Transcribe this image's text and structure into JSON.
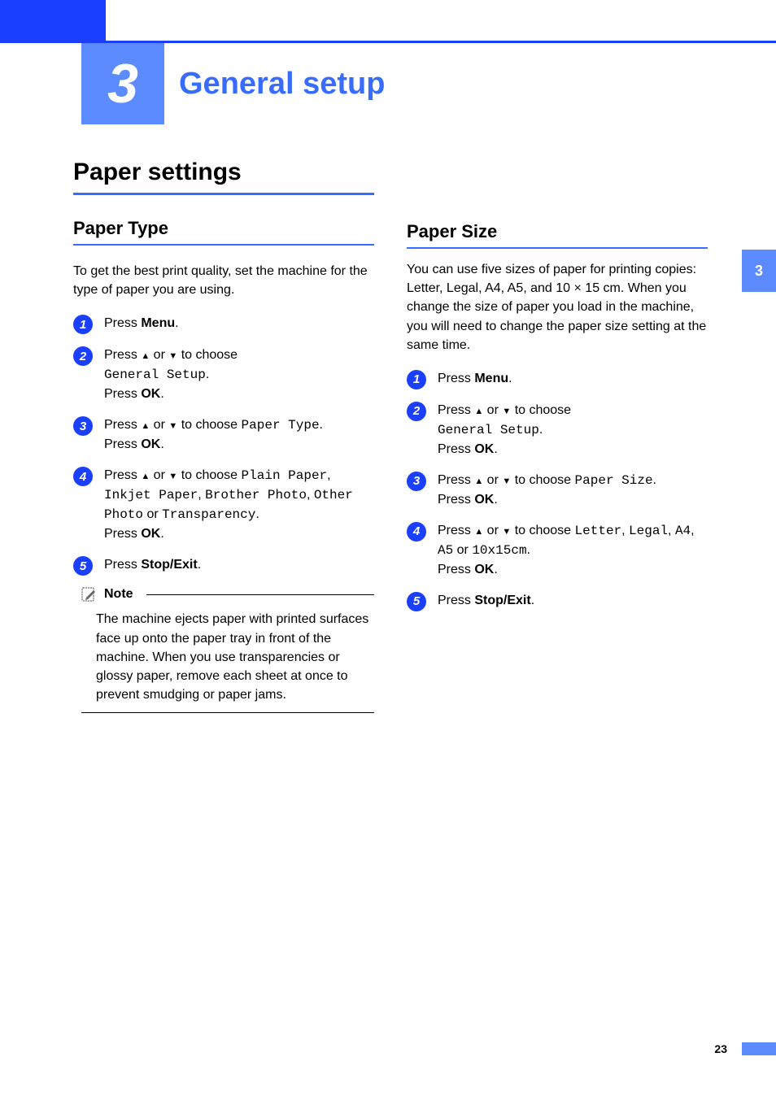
{
  "chapter": {
    "number": "3",
    "title": "General setup"
  },
  "side_tab": "3",
  "page_number": "23",
  "left": {
    "h1": "Paper settings",
    "h2": "Paper Type",
    "intro": "To get the best print quality, set the machine for the type of paper you are using.",
    "steps": {
      "s1": {
        "pre": "Press ",
        "b1": "Menu",
        "post": "."
      },
      "s2": {
        "pre": "Press ",
        "mid": " or ",
        "post": " to choose ",
        "mono": "General Setup",
        "post2": ".",
        "line2a": "Press ",
        "line2b": "OK",
        "line2c": "."
      },
      "s3": {
        "pre": "Press ",
        "mid": " or ",
        "post": " to choose ",
        "mono": "Paper Type",
        "post2": ".",
        "line2a": "Press ",
        "line2b": "OK",
        "line2c": "."
      },
      "s4": {
        "pre": "Press ",
        "mid": " or ",
        "post": " to choose ",
        "m1": "Plain Paper",
        "c1": ", ",
        "m2": "Inkjet Paper",
        "c2": ", ",
        "m3": "Brother Photo",
        "c3": ", ",
        "m4": "Other Photo",
        "or": " or ",
        "m5": "Transparency",
        "c5": ".",
        "line2a": "Press ",
        "line2b": "OK",
        "line2c": "."
      },
      "s5": {
        "pre": "Press ",
        "b1": "Stop/Exit",
        "post": "."
      }
    },
    "note": {
      "title": "Note",
      "body": "The machine ejects paper with printed surfaces face up onto the paper tray in front of the machine. When you use transparencies or glossy paper, remove each sheet at once to prevent smudging or paper jams."
    }
  },
  "right": {
    "h2": "Paper Size",
    "intro": "You can use five sizes of paper for printing copies: Letter, Legal, A4, A5, and 10 × 15 cm. When you change the size of paper you load in the machine, you will need to change the paper size setting at the same time.",
    "steps": {
      "s1": {
        "pre": "Press ",
        "b1": "Menu",
        "post": "."
      },
      "s2": {
        "pre": "Press ",
        "mid": " or ",
        "post": " to choose ",
        "mono": "General Setup",
        "post2": ".",
        "line2a": "Press ",
        "line2b": "OK",
        "line2c": "."
      },
      "s3": {
        "pre": "Press ",
        "mid": " or ",
        "post": " to choose ",
        "mono": "Paper Size",
        "post2": ".",
        "line2a": "Press ",
        "line2b": "OK",
        "line2c": "."
      },
      "s4": {
        "pre": "Press ",
        "mid": " or ",
        "post": " to choose ",
        "m1": "Letter",
        "c1": ", ",
        "m2": "Legal",
        "c2": ", ",
        "m3": "A4",
        "c3": ", ",
        "m4": "A5",
        "or": " or ",
        "m5": "10x15cm",
        "c5": ".",
        "line2a": "Press ",
        "line2b": "OK",
        "line2c": "."
      },
      "s5": {
        "pre": "Press ",
        "b1": "Stop/Exit",
        "post": "."
      }
    }
  }
}
